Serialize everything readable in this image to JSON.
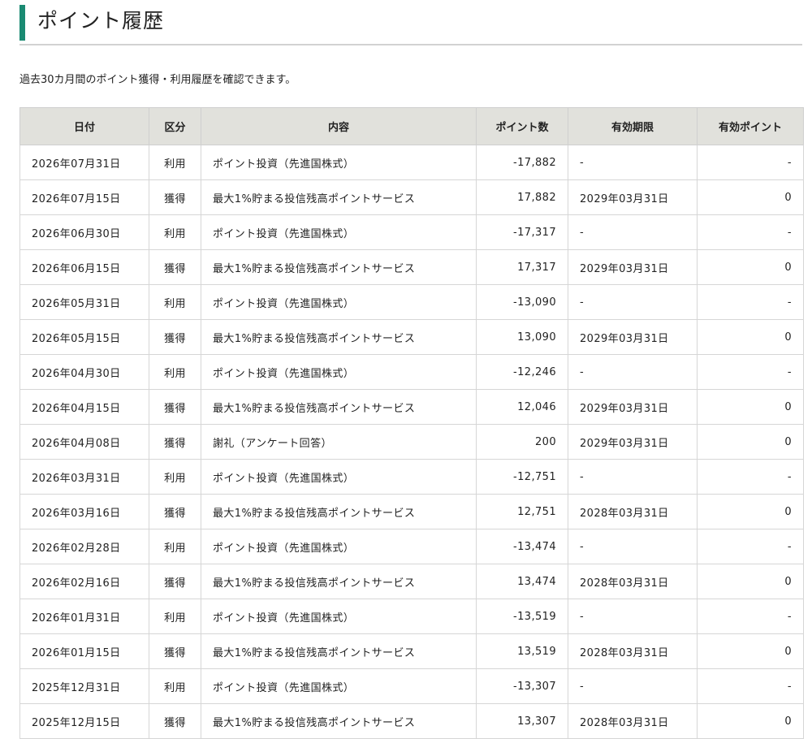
{
  "page": {
    "title": "ポイント履歴",
    "description": "過去30カ月間のポイント獲得・利用履歴を確認できます。"
  },
  "table": {
    "headers": [
      "日付",
      "区分",
      "内容",
      "ポイント数",
      "有効期限",
      "有効ポイント"
    ],
    "rows": [
      {
        "date": "2026年07月31日",
        "type": "利用",
        "content": "ポイント投資（先進国株式）",
        "points": "-17,882",
        "expiry": "-",
        "valid": "-"
      },
      {
        "date": "2026年07月15日",
        "type": "獲得",
        "content": "最大1%貯まる投信残高ポイントサービス",
        "points": "17,882",
        "expiry": "2029年03月31日",
        "valid": "0"
      },
      {
        "date": "2026年06月30日",
        "type": "利用",
        "content": "ポイント投資（先進国株式）",
        "points": "-17,317",
        "expiry": "-",
        "valid": "-"
      },
      {
        "date": "2026年06月15日",
        "type": "獲得",
        "content": "最大1%貯まる投信残高ポイントサービス",
        "points": "17,317",
        "expiry": "2029年03月31日",
        "valid": "0"
      },
      {
        "date": "2026年05月31日",
        "type": "利用",
        "content": "ポイント投資（先進国株式）",
        "points": "-13,090",
        "expiry": "-",
        "valid": "-"
      },
      {
        "date": "2026年05月15日",
        "type": "獲得",
        "content": "最大1%貯まる投信残高ポイントサービス",
        "points": "13,090",
        "expiry": "2029年03月31日",
        "valid": "0"
      },
      {
        "date": "2026年04月30日",
        "type": "利用",
        "content": "ポイント投資（先進国株式）",
        "points": "-12,246",
        "expiry": "-",
        "valid": "-"
      },
      {
        "date": "2026年04月15日",
        "type": "獲得",
        "content": "最大1%貯まる投信残高ポイントサービス",
        "points": "12,046",
        "expiry": "2029年03月31日",
        "valid": "0"
      },
      {
        "date": "2026年04月08日",
        "type": "獲得",
        "content": "謝礼（アンケート回答）",
        "points": "200",
        "expiry": "2029年03月31日",
        "valid": "0"
      },
      {
        "date": "2026年03月31日",
        "type": "利用",
        "content": "ポイント投資（先進国株式）",
        "points": "-12,751",
        "expiry": "-",
        "valid": "-"
      },
      {
        "date": "2026年03月16日",
        "type": "獲得",
        "content": "最大1%貯まる投信残高ポイントサービス",
        "points": "12,751",
        "expiry": "2028年03月31日",
        "valid": "0"
      },
      {
        "date": "2026年02月28日",
        "type": "利用",
        "content": "ポイント投資（先進国株式）",
        "points": "-13,474",
        "expiry": "-",
        "valid": "-"
      },
      {
        "date": "2026年02月16日",
        "type": "獲得",
        "content": "最大1%貯まる投信残高ポイントサービス",
        "points": "13,474",
        "expiry": "2028年03月31日",
        "valid": "0"
      },
      {
        "date": "2026年01月31日",
        "type": "利用",
        "content": "ポイント投資（先進国株式）",
        "points": "-13,519",
        "expiry": "-",
        "valid": "-"
      },
      {
        "date": "2026年01月15日",
        "type": "獲得",
        "content": "最大1%貯まる投信残高ポイントサービス",
        "points": "13,519",
        "expiry": "2028年03月31日",
        "valid": "0"
      },
      {
        "date": "2025年12月31日",
        "type": "利用",
        "content": "ポイント投資（先進国株式）",
        "points": "-13,307",
        "expiry": "-",
        "valid": "-"
      },
      {
        "date": "2025年12月15日",
        "type": "獲得",
        "content": "最大1%貯まる投信残高ポイントサービス",
        "points": "13,307",
        "expiry": "2028年03月31日",
        "valid": "0"
      }
    ]
  },
  "colors": {
    "accent": "#1a8a72",
    "header_bg": "#e1e1dc",
    "border": "#d6d6d6"
  }
}
